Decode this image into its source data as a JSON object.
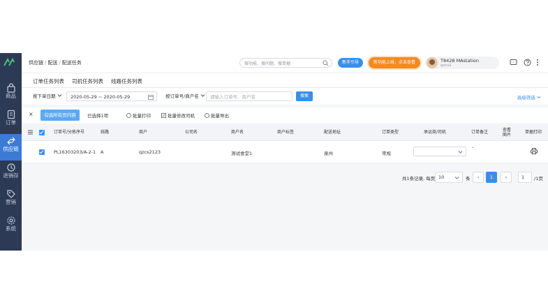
{
  "header": {
    "breadcrumb": [
      "供应链",
      "配送",
      "配送任务"
    ],
    "search_placeholder": "搜功能、搜问题、搜单据",
    "guide_button": "新手引导",
    "promo_button": "新功能上线，点击查看",
    "user_name": "T8428 MAstation",
    "user_sub": "qzcs2"
  },
  "sidebar": {
    "items": [
      {
        "label": "商品",
        "icon": "bag-icon"
      },
      {
        "label": "订单",
        "icon": "order-icon"
      },
      {
        "label": "供应链",
        "icon": "supply-chain-icon",
        "active": true
      },
      {
        "label": "进销存",
        "icon": "inventory-icon"
      },
      {
        "label": "营销",
        "icon": "tag-icon"
      },
      {
        "label": "系统",
        "icon": "gear-icon"
      }
    ]
  },
  "tabs": [
    "订单任务列表",
    "司机任务列表",
    "线路任务列表"
  ],
  "filters": {
    "date_type": "按下单日期",
    "date_range": "2020-05-29 ~ 2020-05-29",
    "search_type": "按订单号/商户名",
    "search_placeholder": "请输入订单号、商户名",
    "search_button": "搜索",
    "advanced": "高级筛选"
  },
  "actions": {
    "close": "×",
    "select_all": "勾选所有页内容",
    "selected": "已选择1项",
    "batch_print": "批量打印",
    "batch_driver": "批量修改司机",
    "batch_export": "批量导出"
  },
  "table": {
    "headers": [
      "订单号/分拣序号",
      "线路",
      "商户",
      "公司名",
      "商户名",
      "商户标签",
      "配送地址",
      "订单类型",
      "承运商/司机",
      "订单备注",
      "查看图片",
      "单据打印"
    ],
    "rows": [
      {
        "order_no": "PL16303203/A-2-1",
        "route": "A",
        "merchant": "qzcs2123",
        "company": "",
        "shop_name": "测试食堂1",
        "label": "",
        "address": "泉州",
        "order_type": "常规",
        "driver": "",
        "remark": "-",
        "image": ""
      }
    ]
  },
  "pager": {
    "summary": "共1条记录, 每页",
    "page_size": "10",
    "unit": "条",
    "prev": "‹",
    "current": "1",
    "next": "›",
    "jump_value": "1",
    "total_pages": "/1页"
  },
  "colors": {
    "primary": "#3b8ee8",
    "sidebar": "#2c3a55",
    "accent_orange": "#f38a1d"
  }
}
